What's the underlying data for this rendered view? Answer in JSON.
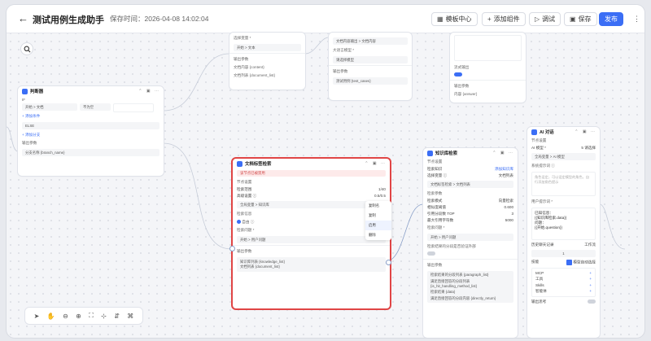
{
  "header": {
    "title": "测试用例生成助手",
    "save_time": "保存时间：2026-04-08 14:02:04",
    "template_center": "模板中心",
    "add_component": "添加组件",
    "debug": "调试",
    "save": "保存",
    "publish": "发布"
  },
  "node_top_a": {
    "select_var": "选择变量 *",
    "row": "开始 > 文本",
    "out_params": "输出参数",
    "out1": "文档内容 {content}",
    "out2": "文档列表 {document_list}"
  },
  "node_top_b": {
    "row1": "文档内容输出 > 文档内容",
    "model_label": "大语言模型 *",
    "model_value": "请选择模型",
    "out_params": "输出参数",
    "out1": "测试用例 {test_cases}"
  },
  "node_top_c": {
    "stream": "流式输出",
    "out_params": "输出参数",
    "out1": "内容 {answer}"
  },
  "judge": {
    "title": "判断器",
    "if": "IF",
    "cond_left": "开始 > 文档",
    "cond_op": "不为空",
    "add_cond": "+ 添加条件",
    "else": "ELSE",
    "add_branch": "+ 添加分支",
    "out_params": "输出参数",
    "out1": "分支名称 {branch_name}"
  },
  "doc_search": {
    "title": "文档标签检索",
    "warn": "该节点已被禁用",
    "section": "节点设置",
    "k1": "检索范围",
    "v1": "1/40",
    "k2": "高级设置 ⓘ",
    "v2": "0.5/0.5",
    "field1": "全局变量 > 知识库",
    "k3": "检索信息",
    "radio": "自由 ⓘ",
    "k4": "检索问题 *",
    "field2": "开始 > 用户问题",
    "out_params": "输出参数",
    "out1": "知识库列表 {knowledge_list}",
    "out2": "文档列表 {document_list}"
  },
  "menu": [
    "复制名",
    "复制",
    "启用",
    "删除"
  ],
  "kb_search": {
    "title": "知识库检索",
    "section": "节点设置",
    "k1": "检索知识",
    "v1": "添加知识库",
    "k2": "选择变量 ⓘ",
    "v2": "文档列表",
    "field1": "文档标签检索 > 文档列表",
    "k3": "检索参数",
    "r1k": "检索模式",
    "r1v": "向量检索",
    "r2k": "相似度阈值",
    "r2v": "0.600",
    "r3k": "引用分段数 TOP",
    "r3v": "3",
    "r4k": "最大引用字符数",
    "r4v": "5000",
    "k4": "检索问题 *",
    "field2": "开始 > 用户问题",
    "k5": "检索结果的分段是否验证外部",
    "out_params": "输出参数",
    "outs": [
      "检索结果的分段列表 {paragraph_list}",
      "满足直接回答的分段列表 {is_hit_handling_method_list}",
      "检索结果 {data}",
      "满足直接回答的分段内容 {directly_return}"
    ]
  },
  "ai_chat": {
    "title": "AI 对话",
    "section": "节点设置",
    "model_label": "AI 模型 *",
    "model_opt": "5 请选择",
    "model_value": "全局变量 > AI 模型",
    "sys_label": "系统提示词 ⓘ",
    "sys_ph": "角色设定，可以设定模型的角色，自行添加角色提示",
    "user_label": "用户提示词 *",
    "user_prompt": "已知信息：\n{{知识库检索.data}}\n问题：\n{{开始.question}}",
    "hist_label": "历史聊天记录",
    "hist_opt": "工作流",
    "hist_value": "1",
    "tools_label": "技能",
    "tools_check": "模型自动选择",
    "tools": [
      "MCP",
      "工具",
      "Skills",
      "智能体"
    ],
    "out_label": "输出思考"
  }
}
